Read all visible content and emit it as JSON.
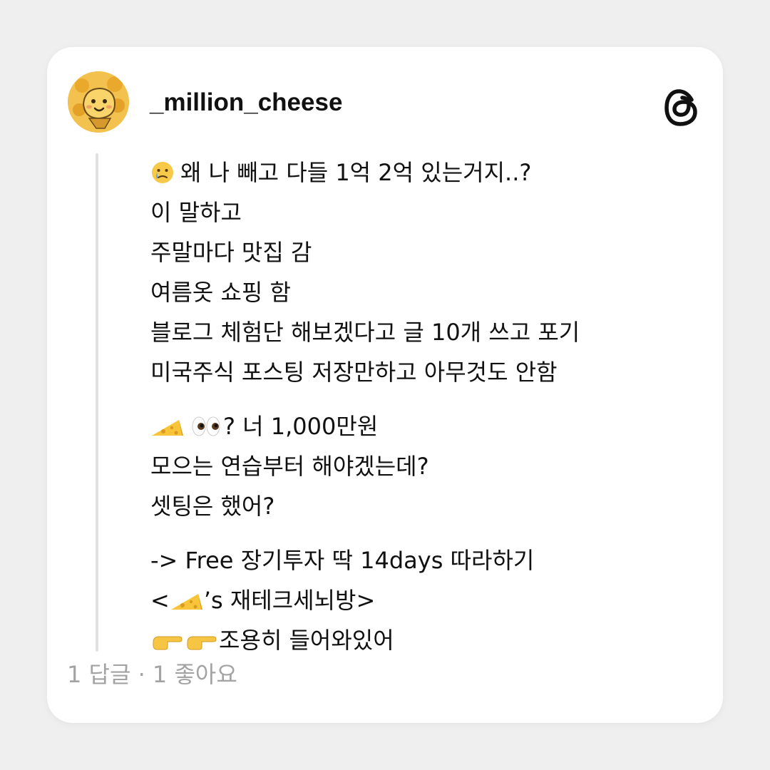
{
  "post": {
    "username": "_million_cheese",
    "avatar_icon": "cheese-mascot-avatar",
    "brand_icon": "threads-logo-icon",
    "lines": [
      {
        "emoji": [
          "sad-tear-face-emoji"
        ],
        "text": "왜 나 빼고 다들 1억 2억 있는거지..?"
      },
      {
        "text": "이 말하고"
      },
      {
        "text": "주말마다 맛집 감"
      },
      {
        "text": "여름옷 쇼핑 함"
      },
      {
        "text": "블로그 체험단 해보겠다고 글 10개 쓰고 포기"
      },
      {
        "text": "미국주식 포스팅 저장만하고 아무것도 안함"
      },
      {
        "emoji": [
          "cheese-emoji",
          "eyes-emoji"
        ],
        "text": "? 너 1,000만원"
      },
      {
        "text": "모으는 연습부터 해야겠는데?"
      },
      {
        "text": "셋팅은 했어?"
      },
      {
        "text": "-> Free 장기투자 딱 14days 따라하기"
      },
      {
        "prefix": "<",
        "emoji": [
          "cheese-emoji"
        ],
        "text": "’s 재테크세뇌방>"
      },
      {
        "emoji": [
          "pointing-right-emoji",
          "pointing-right-emoji"
        ],
        "text": "조용히 들어와있어"
      }
    ],
    "footer": "1 답글 · 1 좋아요"
  },
  "colors": {
    "background": "#efefef",
    "card": "#ffffff",
    "text": "#111111",
    "muted": "#a3a3a3",
    "thread_line": "#e1e1e1"
  }
}
